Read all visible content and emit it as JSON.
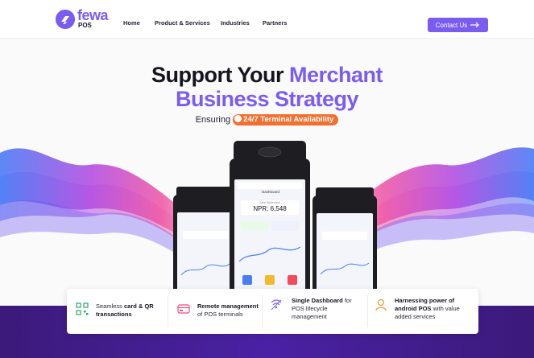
{
  "brand": {
    "name": "fewa",
    "sub": "POS",
    "accent": "#7b5cf0",
    "orange": "#f26f2f"
  },
  "nav": {
    "links": [
      "Home",
      "Product & Services",
      "Industries",
      "Partners"
    ],
    "cta_label": "Contact Us",
    "cta_icon": "arrow-right-icon"
  },
  "hero": {
    "title_line1_a": "Support Your ",
    "title_line1_b": "Merchant",
    "title_line2": "Business Strategy",
    "subtitle_prefix": "Ensuring",
    "subtitle_badge": "24/7 Terminal Availability"
  },
  "pos_screen": {
    "header": "Dashboard",
    "total_label": "Total Settlement",
    "total_value": "NPR: 6,548"
  },
  "features": [
    {
      "pre": "Seamless ",
      "bold": "card & QR transactions",
      "post": "",
      "icon": "qr-code-icon"
    },
    {
      "pre": "",
      "bold": "Remote management",
      "post": " of POS terminals",
      "icon": "terminal-card-icon"
    },
    {
      "pre": "",
      "bold": "Single Dashboard",
      "post": " for POS lifecycle management",
      "icon": "wireless-icon"
    },
    {
      "pre": "",
      "bold": "Harnessing power of android POS",
      "post": " with value added services",
      "icon": "android-user-icon"
    }
  ]
}
